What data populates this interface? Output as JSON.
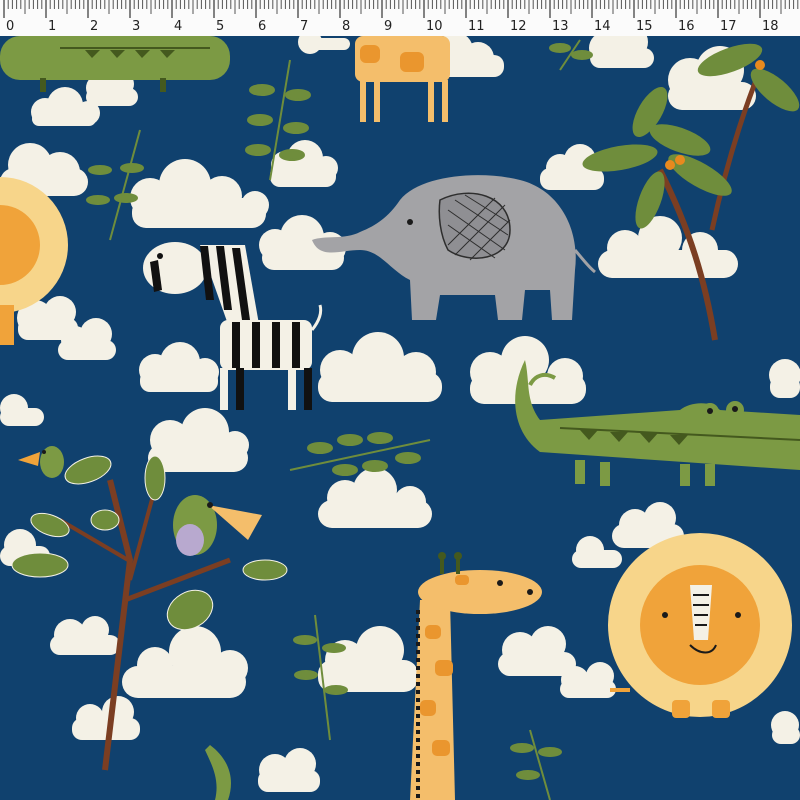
{
  "ruler": {
    "labels": [
      "0",
      "1",
      "2",
      "3",
      "4",
      "5",
      "6",
      "7",
      "8",
      "9",
      "10",
      "11",
      "12",
      "13",
      "14",
      "15",
      "16",
      "17",
      "18"
    ]
  },
  "colors": {
    "background": "#10416e",
    "cloud": "#f4f1e6",
    "ruler_bg": "#fbfbfb",
    "lion_mane": "#f7d58a",
    "lion_face": "#f0a33a",
    "giraffe": "#f4be6b",
    "giraffe_spot": "#ea962e",
    "elephant": "#a3a3a6",
    "croc": "#7c9a44",
    "croc_dark": "#44591e",
    "leaf": "#6f8d3c",
    "trunk": "#7b3e22"
  }
}
